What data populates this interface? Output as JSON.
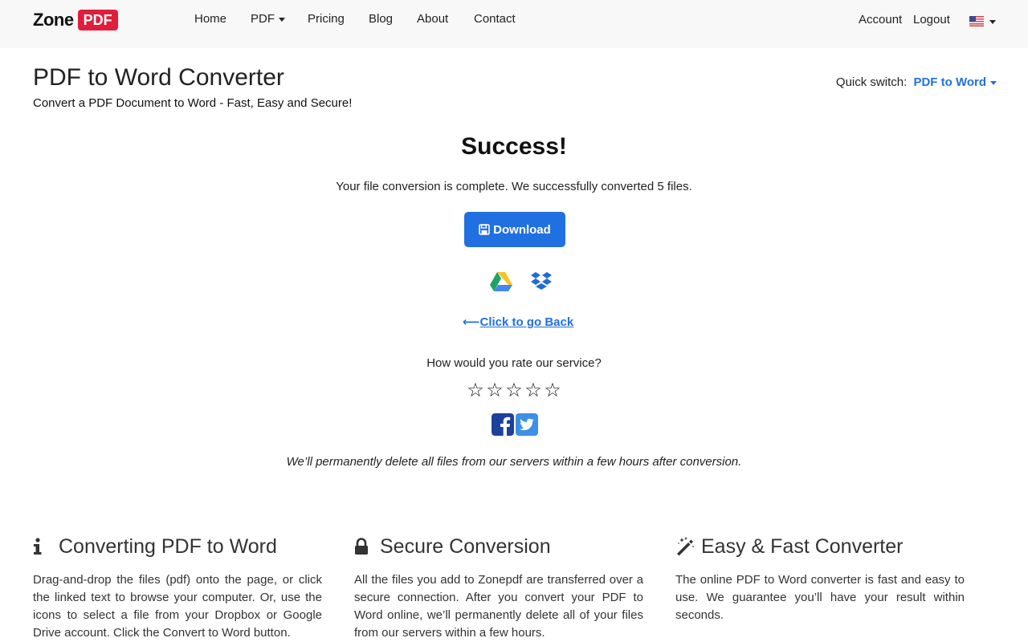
{
  "nav": {
    "logo_zone": "Zone",
    "logo_pdf": "PDF",
    "links": [
      "Home",
      "PDF",
      "Pricing",
      "Blog",
      "About",
      "Contact"
    ],
    "account": "Account",
    "logout": "Logout",
    "language": "English (US)"
  },
  "header": {
    "title": "PDF to Word Converter",
    "subtitle": "Convert a PDF Document to Word - Fast, Easy and Secure!",
    "quick_switch_label": "Quick switch:",
    "quick_switch_value": "PDF to Word"
  },
  "result": {
    "title": "Success!",
    "message": "Your file conversion is complete. We successfully converted 5 files.",
    "download_label": "Download",
    "back_label": "Click to go Back",
    "rate_question": "How would you rate our service?",
    "stars_total": 5,
    "stars_selected": 0,
    "star_glyph": "☆",
    "delete_note": "We’ll permanently delete all files from our servers within a few hours after conversion."
  },
  "features": [
    {
      "icon": "info-icon",
      "title": "Converting PDF to Word",
      "body": "Drag-and-drop the files (pdf) onto the page, or click the linked text to browse your computer. Or, use the icons to select a file from your Dropbox or Google Drive account. Click the Convert to Word button."
    },
    {
      "icon": "lock-icon",
      "title": "Secure Conversion",
      "body": "All the files you add to Zonepdf are transferred over a secure connection. After you convert your PDF to Word online, we’ll permanently delete all of your files from our servers within a few hours."
    },
    {
      "icon": "magic-wand-icon",
      "title": "Easy & Fast Converter",
      "body": "The online PDF to Word converter is fast and easy to use. We guarantee you’ll have your result within seconds."
    }
  ],
  "colors": {
    "brand_red": "#e11d3c",
    "accent_blue": "#2170e2",
    "facebook": "#1d3f9e",
    "twitter": "#3d8fe8"
  }
}
